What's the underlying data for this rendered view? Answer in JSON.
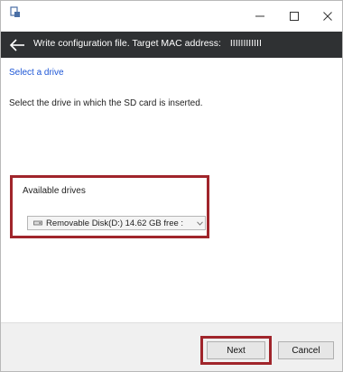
{
  "header": {
    "title": "Write configuration file. Target MAC address:   IIIIIIIIIIII"
  },
  "content": {
    "step_link": "Select a drive",
    "instructions": "Select the drive in which the SD card is inserted."
  },
  "drives": {
    "label": "Available drives",
    "selected": "Removable Disk(D:) 14.62 GB free :"
  },
  "footer": {
    "next_label": "Next",
    "cancel_label": "Cancel"
  },
  "icons": {
    "app": "app-icon",
    "back": "arrow-left-icon",
    "minimize": "minimize-icon",
    "maximize": "maximize-icon",
    "close": "close-icon",
    "drive": "removable-drive-icon",
    "dropdown": "chevron-down-icon"
  },
  "colors": {
    "header_bg": "#2f3133",
    "highlight": "#a0252b",
    "link": "#1d56d6"
  }
}
